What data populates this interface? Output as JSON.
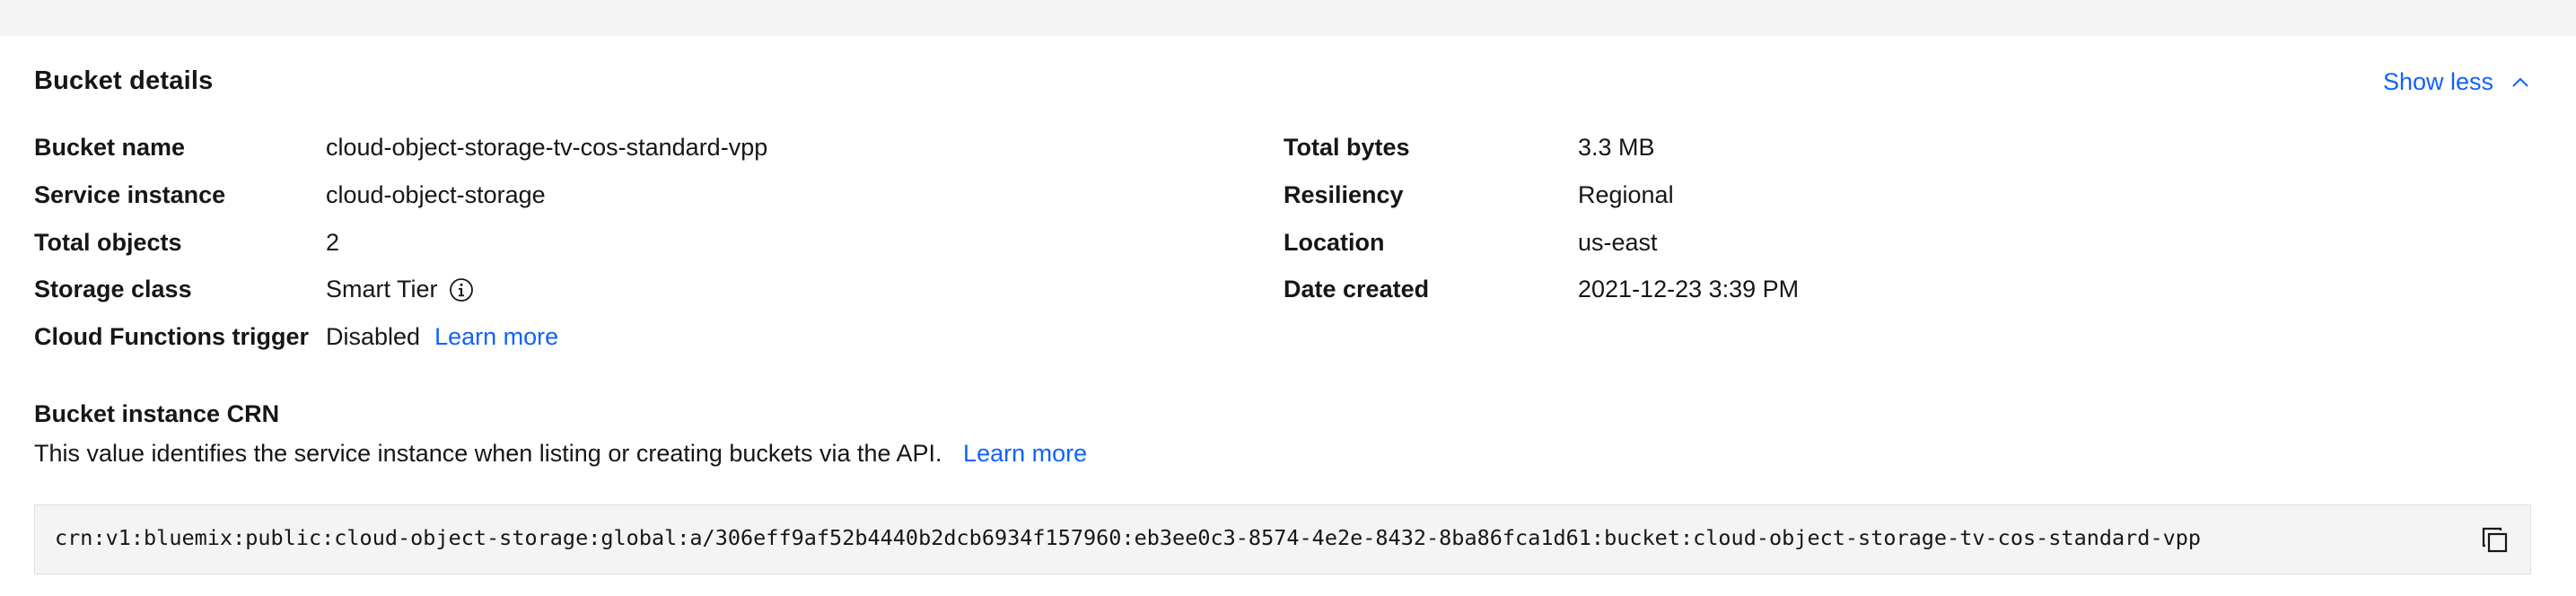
{
  "panel": {
    "title": "Bucket details",
    "toggle_label": "Show less"
  },
  "left_details": [
    {
      "label": "Bucket name",
      "value": "cloud-object-storage-tv-cos-standard-vpp"
    },
    {
      "label": "Service instance",
      "value": "cloud-object-storage"
    },
    {
      "label": "Total objects",
      "value": "2"
    },
    {
      "label": "Storage class",
      "value": "Smart Tier"
    },
    {
      "label": "Cloud Functions trigger",
      "value": "Disabled",
      "link": "Learn more"
    }
  ],
  "right_details": [
    {
      "label": "Total bytes",
      "value": "3.3 MB"
    },
    {
      "label": "Resiliency",
      "value": "Regional"
    },
    {
      "label": "Location",
      "value": "us-east"
    },
    {
      "label": "Date created",
      "value": "2021-12-23 3:39 PM"
    }
  ],
  "crn": {
    "title": "Bucket instance CRN",
    "description": "This value identifies the service instance when listing or creating buckets via the API.",
    "link": "Learn more",
    "value": "crn:v1:bluemix:public:cloud-object-storage:global:a/306eff9af52b4440b2dcb6934f157960:eb3ee0c3-8574-4e2e-8432-8ba86fca1d61:bucket:cloud-object-storage-tv-cos-standard-vpp"
  },
  "icons": {
    "toggle": "chevron-up-icon",
    "storage_class_info": "info-icon",
    "copy": "copy-icon"
  },
  "colors": {
    "link": "#0f62fe",
    "background": "#f4f4f4",
    "card": "#ffffff",
    "text": "#161616"
  }
}
